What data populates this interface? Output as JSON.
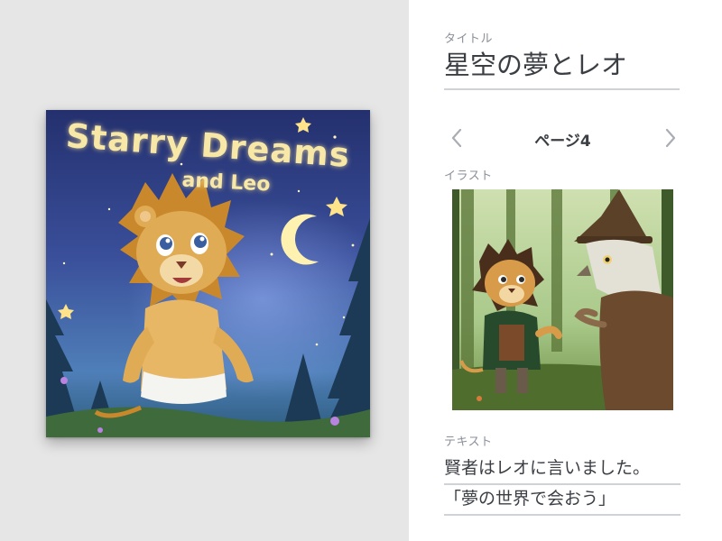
{
  "cover": {
    "title_line1": "Starry Dreams",
    "title_line2": "and Leo"
  },
  "form": {
    "title_label": "タイトル",
    "title_value": "星空の夢とレオ",
    "page_label": "ページ4",
    "prev_icon": "chevron-left-icon",
    "next_icon": "chevron-right-icon",
    "illustration_label": "イラスト",
    "text_label": "テキスト",
    "text_line1": "賢者はレオに言いました。",
    "text_line2": "「夢の世界で会おう」"
  },
  "colors": {
    "cover_sky": "#3a4f9a",
    "panel_bg": "#e6e6e6",
    "label_gray": "#8a8f98",
    "text_dark": "#3b3f44",
    "rule_gray": "#cfd2d6"
  }
}
